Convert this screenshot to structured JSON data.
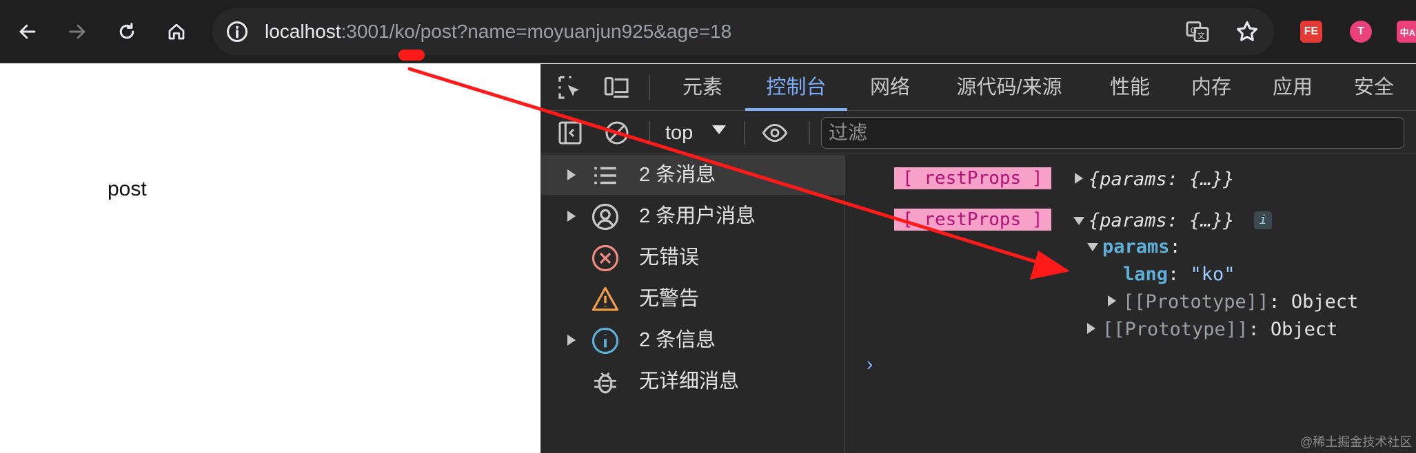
{
  "browser": {
    "url": {
      "host": "localhost",
      "rest": ":3001/ko/post?name=moyuanjun925&age=18"
    },
    "nav_icons": [
      "back-arrow-icon",
      "forward-arrow-icon",
      "reload-icon",
      "home-icon"
    ],
    "extensions": [
      {
        "name": "fe-extension-icon",
        "label": "FE",
        "color": "#e53935"
      },
      {
        "name": "translate-extension-icon",
        "label": "T",
        "color": "#ec407a"
      },
      {
        "name": "pinyin-extension-icon",
        "label": "中A",
        "color": "#ec407a"
      }
    ]
  },
  "page": {
    "text": "post"
  },
  "devtools": {
    "tabs": [
      "元素",
      "控制台",
      "网络",
      "源代码/来源",
      "性能",
      "内存",
      "应用",
      "安全"
    ],
    "active_tab": "控制台",
    "context": "top",
    "filter_placeholder": "过滤",
    "sidebar": [
      {
        "label": "2 条消息",
        "icon": "list-icon",
        "expandable": true,
        "selected": true
      },
      {
        "label": "2 条用户消息",
        "icon": "user-icon",
        "expandable": true,
        "selected": false
      },
      {
        "label": "无错误",
        "icon": "error-icon",
        "expandable": false,
        "selected": false
      },
      {
        "label": "无警告",
        "icon": "warning-icon",
        "expandable": false,
        "selected": false
      },
      {
        "label": "2 条信息",
        "icon": "info-icon",
        "expandable": true,
        "selected": false
      },
      {
        "label": "无详细消息",
        "icon": "bug-icon",
        "expandable": false,
        "selected": false
      }
    ],
    "console": {
      "badge": "[ restProps ]",
      "object_collapsed": "{params: {…}}",
      "info_mark": "i",
      "params_key": "params",
      "lang_key": "lang",
      "lang_value": "\"ko\"",
      "proto_label": "[[Prototype]]",
      "proto_value": "Object",
      "prompt": "›"
    }
  },
  "watermark": "@稀土掘金技术社区",
  "colors": {
    "annotation": "#ff1a1a",
    "active_tab": "#7cacf8",
    "badge_bg": "#f7a1c8"
  }
}
